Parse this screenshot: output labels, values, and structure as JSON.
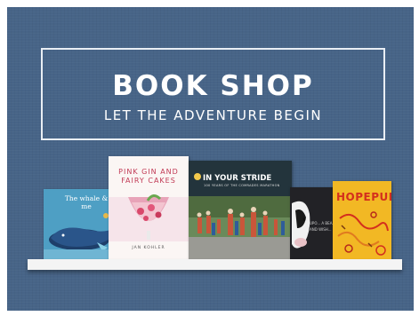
{
  "banner": {
    "title": "BOOK SHOP",
    "subtitle": "LET THE ADVENTURE BEGIN"
  },
  "books": [
    {
      "title": "The whale & me"
    },
    {
      "title": "PINK GIN AND FAIRY CAKES",
      "author": "JAN KOHLER"
    },
    {
      "title": "IN YOUR STRIDE",
      "subtitle": "100 YEARS OF THE COMRADES MARATHON"
    },
    {
      "title": "UPO... A BEA... AND WISH..."
    },
    {
      "title": "HOPEPUNK"
    }
  ],
  "colors": {
    "background": "#476487",
    "banner_border": "#e9eef4",
    "shelf": "#f4f4f4"
  }
}
